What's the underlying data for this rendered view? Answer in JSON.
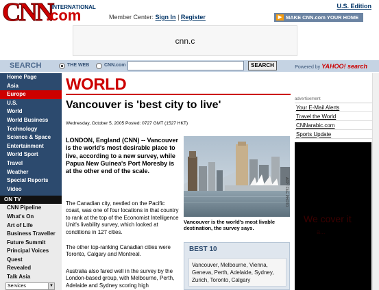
{
  "header": {
    "logo_cnn": "CNN",
    "logo_com": ".com",
    "logo_intl": "INTERNATIONAL",
    "edition": "U.S. Edition",
    "member_label": "Member Center:",
    "sign_in": "Sign In",
    "separator": "|",
    "register": "Register",
    "homepage_button": "MAKE CNN.com YOUR HOME PAGE",
    "ad_text": "cnn.c"
  },
  "search": {
    "title": "SEARCH",
    "option_web": "THE WEB",
    "option_cnn": "CNN.com",
    "button": "SEARCH",
    "powered_by": "Powered by",
    "yahoo": "YAHOO! search",
    "value": ""
  },
  "nav": {
    "items": [
      "Home Page",
      "Asia",
      "Europe",
      "U.S.",
      "World",
      "World Business",
      "Technology",
      "Science & Space",
      "Entertainment",
      "World Sport",
      "Travel",
      "Weather",
      "Special Reports",
      "Video"
    ],
    "active": "Europe",
    "on_tv_title": "ON TV",
    "on_tv_items": [
      "CNN Pipeline",
      "What's On",
      "Art of Life",
      "Business Traveller",
      "Future Summit",
      "Principal Voices",
      "Quest",
      "Revealed",
      "Talk Asia"
    ],
    "select_value": "Services"
  },
  "article": {
    "section": "WORLD",
    "headline": "Vancouver is 'best city to live'",
    "dateline": "Wednesday, October 5, 2005 Posted: 0727 GMT (1527 HKT)",
    "lead": "LONDON, England (CNN) -- Vancouver is the world's most desirable place to live, according to a new survey, while Papua New Guinea's Port Moresby is at the other end of the scale.",
    "paragraphs": [
      "The Canadian city, nestled on the Pacific coast, was one of four locations in that country to rank at the top of the Economist Intelligence Unit's livability survey, which looked at conditions in 127 cities.",
      "The other top-ranking Canadian cities were Toronto, Calgary and Montreal.",
      "Australia also fared well in the survey by the London-based group, with Melbourne, Perth, Adelaide and Sydney scoring high"
    ],
    "photo_credit": "AFP / FILE PHOTO",
    "caption": "Vancouver is the world's most livable destination, the survey says.",
    "best_title": "BEST 10",
    "best_list": "Vancouver, Melbourne, Vienna, Geneva, Perth, Adelaide, Sydney, Zurich, Toronto, Calgary"
  },
  "right": {
    "ad_label": "advertisement",
    "links": [
      "Your E-Mail Alerts",
      "Travel the World",
      "CNNarabic.com",
      "Sports Update"
    ],
    "ad_line1": "We cover it",
    "ad_line2": "a..."
  },
  "colors": {
    "brand_red": "#cc0000",
    "nav_blue": "#2c4a6e",
    "search_bar": "#c5d3e3"
  }
}
